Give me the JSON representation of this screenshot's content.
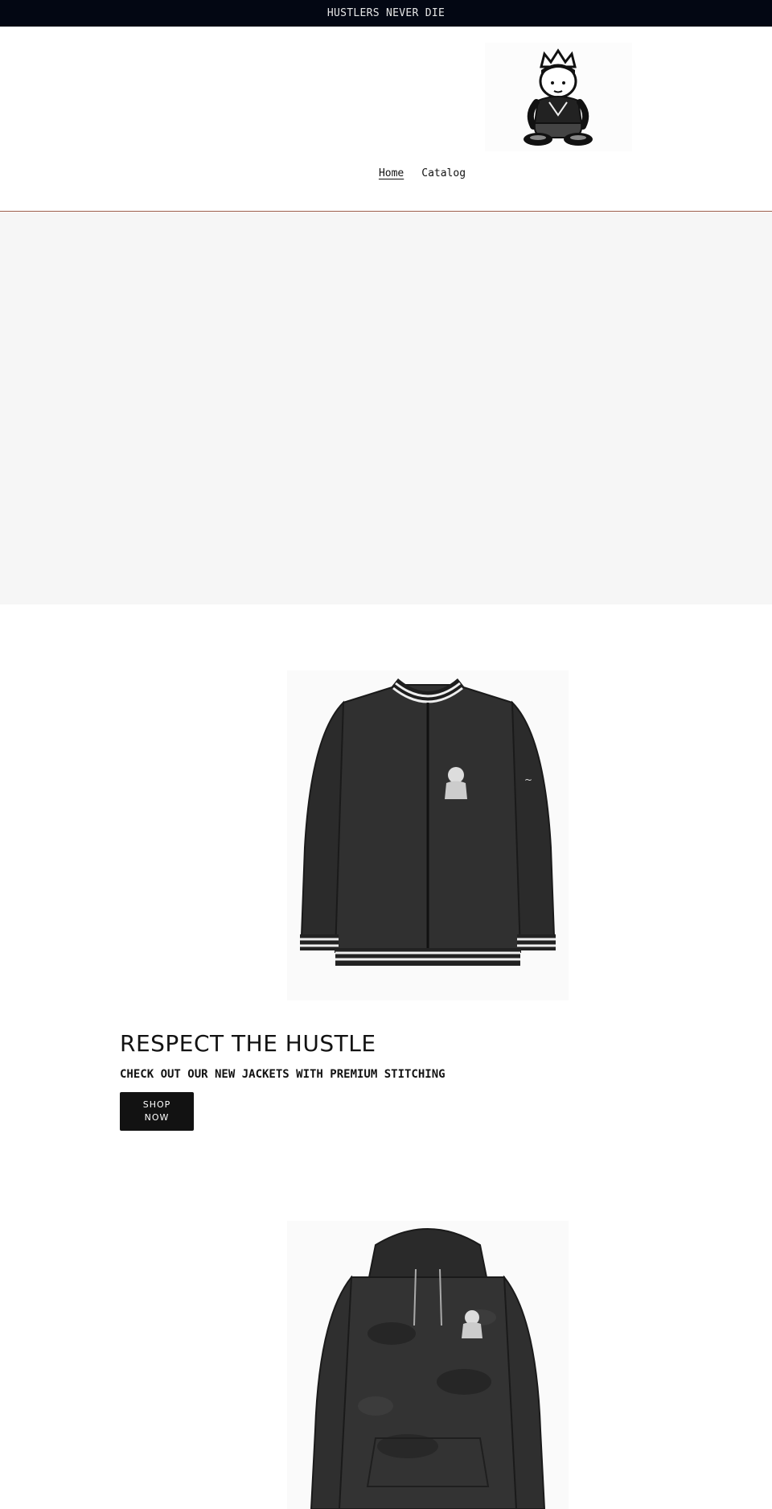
{
  "announcement": {
    "text": "HUSTLERS NEVER DIE"
  },
  "header": {
    "logo_icon": "crowned-kid-logo-icon",
    "nav": [
      {
        "label": "Home",
        "active": true
      },
      {
        "label": "Catalog",
        "active": false
      }
    ]
  },
  "feature": {
    "title": "RESPECT THE HUSTLE",
    "subtitle": "CHECK OUT OUR NEW JACKETS WITH PREMIUM STITCHING",
    "button_label": "SHOP NOW"
  },
  "colors": {
    "announcement_bg": "#030713",
    "header_border": "#9b5c4a",
    "hero_bg": "#f6f6f6",
    "button_bg": "#121212"
  }
}
